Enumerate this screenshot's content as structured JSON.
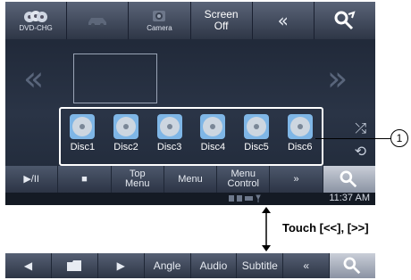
{
  "topbar": {
    "dvd_chg_label": "DVD-CHG",
    "camera_label": "Camera",
    "screen_off_line1": "Screen",
    "screen_off_line2": "Off",
    "collapse_glyph": "«"
  },
  "discs": [
    {
      "label": "Disc1"
    },
    {
      "label": "Disc2"
    },
    {
      "label": "Disc3"
    },
    {
      "label": "Disc4"
    },
    {
      "label": "Disc5"
    },
    {
      "label": "Disc6"
    }
  ],
  "controls": {
    "play_pause": "▶/II",
    "stop": "■",
    "top_menu_line1": "Top",
    "top_menu_line2": "Menu",
    "menu": "Menu",
    "menu_control_line1": "Menu",
    "menu_control_line2": "Control",
    "more": "»"
  },
  "status": {
    "time": "11:37 AM"
  },
  "callout": {
    "number": "1"
  },
  "touch_label": "Touch [<<], [>>]",
  "bottombar": {
    "prev": "◀",
    "next": "▶",
    "angle": "Angle",
    "audio": "Audio",
    "subtitle": "Subtitle",
    "collapse": "«"
  },
  "colors": {
    "screen_bg": "#1c2433",
    "disc_blue": "#7fb6e6"
  }
}
